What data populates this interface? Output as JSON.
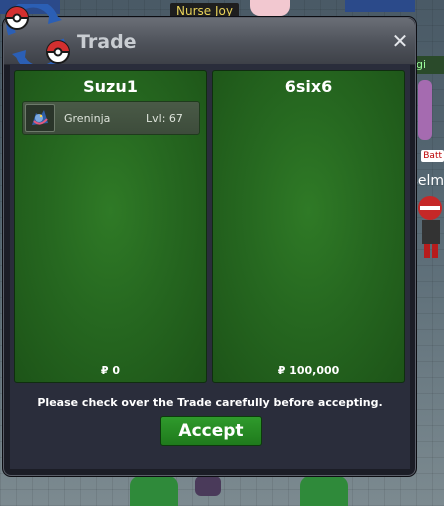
{
  "background": {
    "npc_label": "Nurse Joy",
    "side_tag": "gi",
    "side_battle": "Batt",
    "side_name": "selm"
  },
  "window": {
    "title": "Trade",
    "close_glyph": "✕",
    "logo_icon": "pokeball-trade-logo-icon"
  },
  "trade": {
    "left": {
      "name": "Suzu1",
      "money": "₽ 0",
      "items": [
        {
          "pokemon": "Greninja",
          "level": "Lvl: 67",
          "icon": "greninja-sprite-icon"
        }
      ]
    },
    "right": {
      "name": "6six6",
      "money": "₽ 100,000",
      "items": []
    },
    "notice": "Please check over the Trade carefully before accepting.",
    "accept_label": "Accept"
  },
  "colors": {
    "panel_green": "#266820",
    "accept_green": "#1f7a1c",
    "window_dark": "#1b1d26"
  }
}
